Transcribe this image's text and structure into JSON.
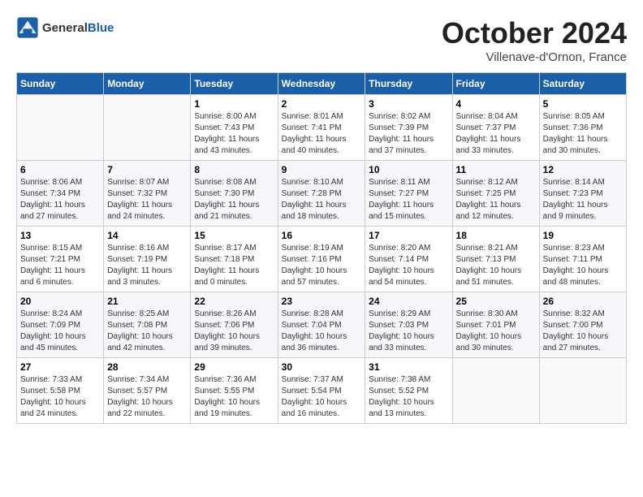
{
  "logo": {
    "text_general": "General",
    "text_blue": "Blue"
  },
  "title": "October 2024",
  "subtitle": "Villenave-d'Ornon, France",
  "headers": [
    "Sunday",
    "Monday",
    "Tuesday",
    "Wednesday",
    "Thursday",
    "Friday",
    "Saturday"
  ],
  "weeks": [
    [
      {
        "day": "",
        "info": ""
      },
      {
        "day": "",
        "info": ""
      },
      {
        "day": "1",
        "info": "Sunrise: 8:00 AM\nSunset: 7:43 PM\nDaylight: 11 hours and 43 minutes."
      },
      {
        "day": "2",
        "info": "Sunrise: 8:01 AM\nSunset: 7:41 PM\nDaylight: 11 hours and 40 minutes."
      },
      {
        "day": "3",
        "info": "Sunrise: 8:02 AM\nSunset: 7:39 PM\nDaylight: 11 hours and 37 minutes."
      },
      {
        "day": "4",
        "info": "Sunrise: 8:04 AM\nSunset: 7:37 PM\nDaylight: 11 hours and 33 minutes."
      },
      {
        "day": "5",
        "info": "Sunrise: 8:05 AM\nSunset: 7:36 PM\nDaylight: 11 hours and 30 minutes."
      }
    ],
    [
      {
        "day": "6",
        "info": "Sunrise: 8:06 AM\nSunset: 7:34 PM\nDaylight: 11 hours and 27 minutes."
      },
      {
        "day": "7",
        "info": "Sunrise: 8:07 AM\nSunset: 7:32 PM\nDaylight: 11 hours and 24 minutes."
      },
      {
        "day": "8",
        "info": "Sunrise: 8:08 AM\nSunset: 7:30 PM\nDaylight: 11 hours and 21 minutes."
      },
      {
        "day": "9",
        "info": "Sunrise: 8:10 AM\nSunset: 7:28 PM\nDaylight: 11 hours and 18 minutes."
      },
      {
        "day": "10",
        "info": "Sunrise: 8:11 AM\nSunset: 7:27 PM\nDaylight: 11 hours and 15 minutes."
      },
      {
        "day": "11",
        "info": "Sunrise: 8:12 AM\nSunset: 7:25 PM\nDaylight: 11 hours and 12 minutes."
      },
      {
        "day": "12",
        "info": "Sunrise: 8:14 AM\nSunset: 7:23 PM\nDaylight: 11 hours and 9 minutes."
      }
    ],
    [
      {
        "day": "13",
        "info": "Sunrise: 8:15 AM\nSunset: 7:21 PM\nDaylight: 11 hours and 6 minutes."
      },
      {
        "day": "14",
        "info": "Sunrise: 8:16 AM\nSunset: 7:19 PM\nDaylight: 11 hours and 3 minutes."
      },
      {
        "day": "15",
        "info": "Sunrise: 8:17 AM\nSunset: 7:18 PM\nDaylight: 11 hours and 0 minutes."
      },
      {
        "day": "16",
        "info": "Sunrise: 8:19 AM\nSunset: 7:16 PM\nDaylight: 10 hours and 57 minutes."
      },
      {
        "day": "17",
        "info": "Sunrise: 8:20 AM\nSunset: 7:14 PM\nDaylight: 10 hours and 54 minutes."
      },
      {
        "day": "18",
        "info": "Sunrise: 8:21 AM\nSunset: 7:13 PM\nDaylight: 10 hours and 51 minutes."
      },
      {
        "day": "19",
        "info": "Sunrise: 8:23 AM\nSunset: 7:11 PM\nDaylight: 10 hours and 48 minutes."
      }
    ],
    [
      {
        "day": "20",
        "info": "Sunrise: 8:24 AM\nSunset: 7:09 PM\nDaylight: 10 hours and 45 minutes."
      },
      {
        "day": "21",
        "info": "Sunrise: 8:25 AM\nSunset: 7:08 PM\nDaylight: 10 hours and 42 minutes."
      },
      {
        "day": "22",
        "info": "Sunrise: 8:26 AM\nSunset: 7:06 PM\nDaylight: 10 hours and 39 minutes."
      },
      {
        "day": "23",
        "info": "Sunrise: 8:28 AM\nSunset: 7:04 PM\nDaylight: 10 hours and 36 minutes."
      },
      {
        "day": "24",
        "info": "Sunrise: 8:29 AM\nSunset: 7:03 PM\nDaylight: 10 hours and 33 minutes."
      },
      {
        "day": "25",
        "info": "Sunrise: 8:30 AM\nSunset: 7:01 PM\nDaylight: 10 hours and 30 minutes."
      },
      {
        "day": "26",
        "info": "Sunrise: 8:32 AM\nSunset: 7:00 PM\nDaylight: 10 hours and 27 minutes."
      }
    ],
    [
      {
        "day": "27",
        "info": "Sunrise: 7:33 AM\nSunset: 5:58 PM\nDaylight: 10 hours and 24 minutes."
      },
      {
        "day": "28",
        "info": "Sunrise: 7:34 AM\nSunset: 5:57 PM\nDaylight: 10 hours and 22 minutes."
      },
      {
        "day": "29",
        "info": "Sunrise: 7:36 AM\nSunset: 5:55 PM\nDaylight: 10 hours and 19 minutes."
      },
      {
        "day": "30",
        "info": "Sunrise: 7:37 AM\nSunset: 5:54 PM\nDaylight: 10 hours and 16 minutes."
      },
      {
        "day": "31",
        "info": "Sunrise: 7:38 AM\nSunset: 5:52 PM\nDaylight: 10 hours and 13 minutes."
      },
      {
        "day": "",
        "info": ""
      },
      {
        "day": "",
        "info": ""
      }
    ]
  ]
}
